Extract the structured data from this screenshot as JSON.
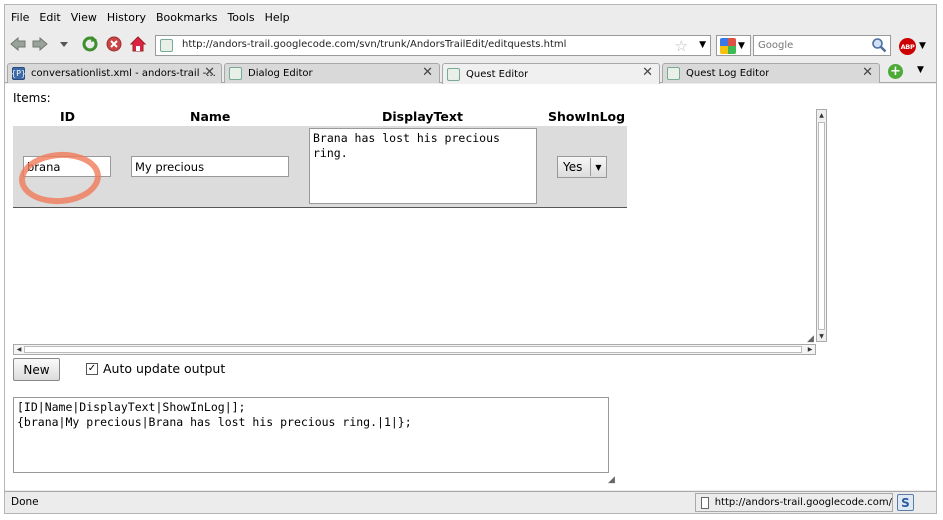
{
  "menu": [
    "File",
    "Edit",
    "View",
    "History",
    "Bookmarks",
    "Tools",
    "Help"
  ],
  "navbar": {
    "url": "http://andors-trail.googlecode.com/svn/trunk/AndorsTrailEdit/editquests.html",
    "search_placeholder": "Google",
    "abp_label": "ABP"
  },
  "tabs": [
    {
      "label": "conversationlist.xml - andors-trail -...",
      "favicon": "{P}"
    },
    {
      "label": "Dialog Editor"
    },
    {
      "label": "Quest Editor"
    },
    {
      "label": "Quest Log Editor"
    }
  ],
  "editor": {
    "items_label": "Items:",
    "columns": [
      "ID",
      "Name",
      "DisplayText",
      "ShowInLog"
    ],
    "row": {
      "id": "brana",
      "name": "My precious",
      "display_text": "Brana has lost his precious ring.",
      "show_in_log": "Yes"
    },
    "new_button": "New",
    "auto_update_label": "Auto update output",
    "auto_update_checked": true,
    "output": "[ID|Name|DisplayText|ShowInLog|];\n{brana|My precious|Brana has lost his precious ring.|1|};"
  },
  "status": {
    "text": "Done",
    "url": "http://andors-trail.googlecode.com/"
  },
  "colors": {
    "highlight_circle": "#f07a5a",
    "row_background": "#dcdcdc"
  }
}
